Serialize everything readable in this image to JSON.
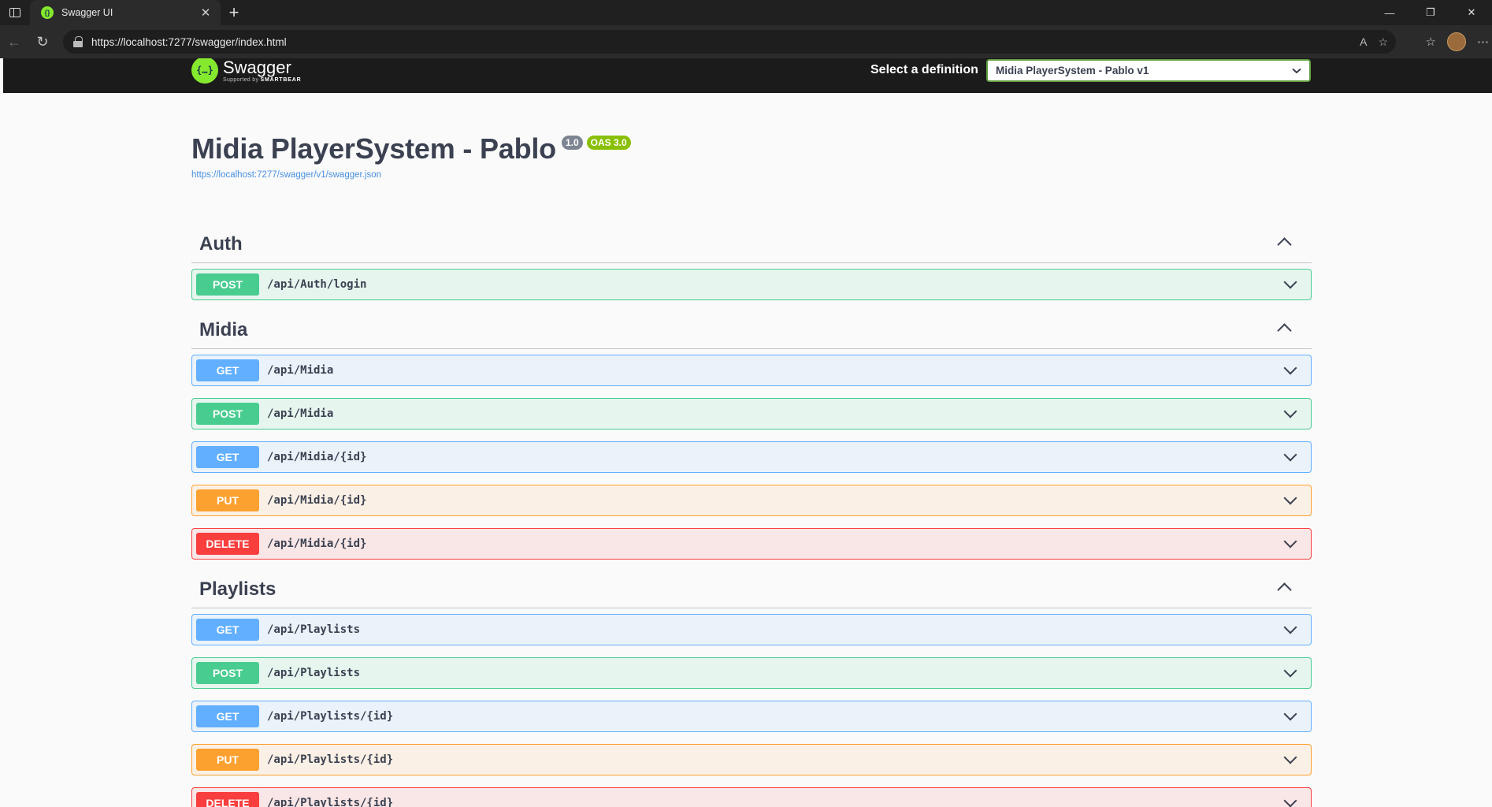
{
  "browser": {
    "tab_title": "Swagger UI",
    "url": "https://localhost:7277/swagger/index.html"
  },
  "topbar": {
    "logo_word": "Swagger",
    "logo_sub_prefix": "Supported by",
    "logo_sub_brand": "SMARTBEAR",
    "definition_label": "Select a definition",
    "definition_value": "Midia PlayerSystem - Pablo v1"
  },
  "info": {
    "title": "Midia PlayerSystem - Pablo",
    "version": "1.0",
    "oas": "OAS 3.0",
    "spec_url": "https://localhost:7277/swagger/v1/swagger.json"
  },
  "tags": [
    {
      "name": "Auth",
      "operations": [
        {
          "method": "POST",
          "path": "/api/Auth/login"
        }
      ]
    },
    {
      "name": "Midia",
      "operations": [
        {
          "method": "GET",
          "path": "/api/Midia"
        },
        {
          "method": "POST",
          "path": "/api/Midia"
        },
        {
          "method": "GET",
          "path": "/api/Midia/{id}"
        },
        {
          "method": "PUT",
          "path": "/api/Midia/{id}"
        },
        {
          "method": "DELETE",
          "path": "/api/Midia/{id}"
        }
      ]
    },
    {
      "name": "Playlists",
      "operations": [
        {
          "method": "GET",
          "path": "/api/Playlists"
        },
        {
          "method": "POST",
          "path": "/api/Playlists"
        },
        {
          "method": "GET",
          "path": "/api/Playlists/{id}"
        },
        {
          "method": "PUT",
          "path": "/api/Playlists/{id}"
        },
        {
          "method": "DELETE",
          "path": "/api/Playlists/{id}"
        }
      ]
    }
  ],
  "colors": {
    "get": "#61affe",
    "post": "#49cc90",
    "put": "#fca130",
    "delete": "#f93e3e",
    "swagger_green": "#85ea2d"
  }
}
